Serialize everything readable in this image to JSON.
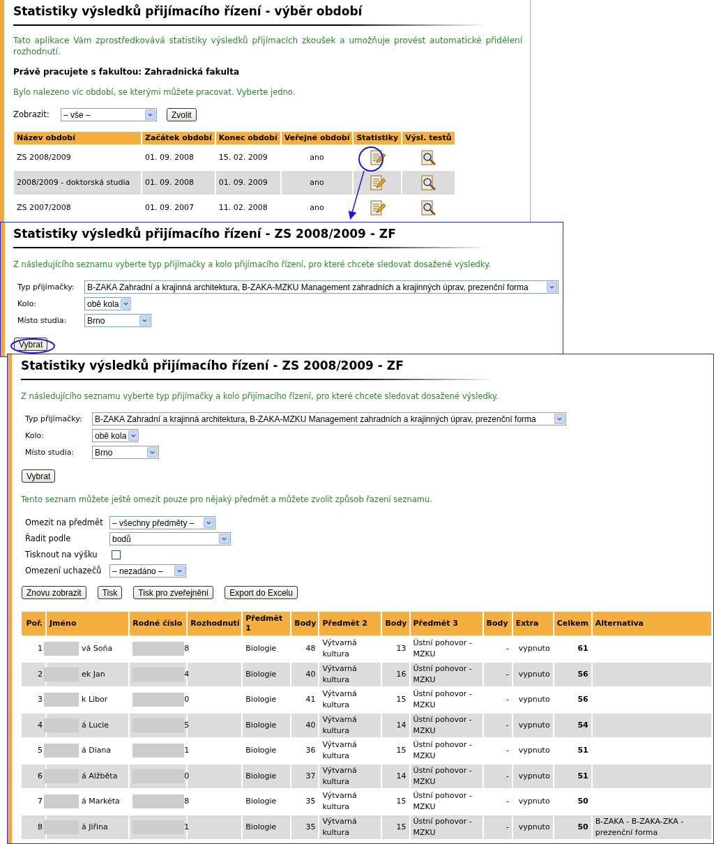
{
  "period_page": {
    "title": "Statistiky výsledků přijímacího řízení - výběr období",
    "intro": "Tato aplikace Vám zprostředkovává statistiky výsledků přijímacích zkoušek a umožňuje provést automatické přidělení rozhodnutí.",
    "faculty": "Právě pracujete s fakultou: Zahradnická fakulta",
    "info": "Bylo nalezeno víc období, se kterými můžete pracovat. Vyberte jedno.",
    "filter": {
      "label": "Zobrazit:",
      "value": "– vše –",
      "button": "Zvolit"
    },
    "table": {
      "columns": [
        "Název období",
        "Začátek období",
        "Konec období",
        "Veřejné období",
        "Statistiky",
        "Výsl. testů"
      ],
      "rows": [
        {
          "name": "ZS 2008/2009",
          "start": "01. 09. 2008",
          "end": "15. 02. 2009",
          "public": "ano"
        },
        {
          "name": "2008/2009 - doktorská studia",
          "start": "01. 09. 2008",
          "end": "01. 09. 2009",
          "public": "ano"
        },
        {
          "name": "ZS 2007/2008",
          "start": "01. 09. 2007",
          "end": "11. 02. 2008",
          "public": "ano"
        }
      ]
    }
  },
  "selection_page": {
    "title": "Statistiky výsledků přijímacího řízení - ZS 2008/2009 - ZF",
    "intro": "Z následujícího seznamu vyberte typ přijímačky a kolo přijímacího řízení, pro které chcete sledovat dosažené výsledky.",
    "fields": [
      {
        "label": "Typ přijímačky:",
        "value": "B-ZAKA Zahradní a krajinná architektura, B-ZAKA-MZKU Management zahradních a krajinných úprav, prezenční forma"
      },
      {
        "label": "Kolo:",
        "value": "obě kola"
      },
      {
        "label": "Místo studia:",
        "value": "Brno"
      }
    ],
    "button": "Vybrat"
  },
  "results_page": {
    "title": "Statistiky výsledků přijímacího řízení - ZS 2008/2009 - ZF",
    "intro": "Z následujícího seznamu vyberte typ přijímačky a kolo přijímacího řízení, pro které chcete sledovat dosažené výsledky.",
    "fields": [
      {
        "label": "Typ přijímačky:",
        "value": "B-ZAKA Zahradní a krajinná architektura, B-ZAKA-MZKU Management zahradních a krajinných úprav, prezenční forma"
      },
      {
        "label": "Kolo:",
        "value": "obě kola"
      },
      {
        "label": "Místo studia:",
        "value": "Brno"
      }
    ],
    "button": "Vybrat",
    "filter_intro": "Tento seznam můžete ještě omezit pouze pro nějaký předmět a můžete zvolit způsob řazení seznamu.",
    "options": [
      {
        "kind": "select",
        "label": "Omezit na předmět",
        "value": "– všechny předměty –"
      },
      {
        "kind": "select",
        "label": "Řadit podle",
        "value": "bodů"
      },
      {
        "kind": "checkbox",
        "label": "Tisknout na výšku",
        "checked": false
      },
      {
        "kind": "select",
        "label": "Omezení uchazečů",
        "value": "– nezadáno –"
      }
    ],
    "actions": [
      "Znovu zobrazit",
      "Tisk",
      "Tisk pro zveřejnění",
      "Export do Excelu"
    ],
    "table": {
      "columns": [
        "Poř.",
        "Jméno",
        "Rodné číslo",
        "Rozhodnutí",
        "Předmět 1",
        "Body",
        "Předmět 2",
        "Body",
        "Předmět 3",
        "Body",
        "Extra",
        "Celkem",
        "Alternativa"
      ],
      "rows": [
        {
          "order": "1",
          "name": "vá Soňa",
          "birth_number": "8",
          "subject_1": "Biologie",
          "points_1": "48",
          "subject_2": "Výtvarná kultura",
          "points_2": "13",
          "subject_3": "Ústní pohovor - MZKU",
          "points_3": "-",
          "extra": "vypnuto",
          "total": "61"
        },
        {
          "order": "2",
          "name": "ek Jan",
          "birth_number": "4",
          "subject_1": "Biologie",
          "points_1": "40",
          "subject_2": "Výtvarná kultura",
          "points_2": "16",
          "subject_3": "Ústní pohovor - MZKU",
          "points_3": "-",
          "extra": "vypnuto",
          "total": "56"
        },
        {
          "order": "3",
          "name": "k Libor",
          "birth_number": "0",
          "subject_1": "Biologie",
          "points_1": "41",
          "subject_2": "Výtvarná kultura",
          "points_2": "15",
          "subject_3": "Ústní pohovor - MZKU",
          "points_3": "-",
          "extra": "vypnuto",
          "total": "56"
        },
        {
          "order": "4",
          "name": "á Lucie",
          "birth_number": "5",
          "subject_1": "Biologie",
          "points_1": "40",
          "subject_2": "Výtvarná kultura",
          "points_2": "14",
          "subject_3": "Ústní pohovor - MZKU",
          "points_3": "-",
          "extra": "vypnuto",
          "total": "54"
        },
        {
          "order": "5",
          "name": "á Diana",
          "birth_number": "1",
          "subject_1": "Biologie",
          "points_1": "36",
          "subject_2": "Výtvarná kultura",
          "points_2": "15",
          "subject_3": "Ústní pohovor - MZKU",
          "points_3": "-",
          "extra": "vypnuto",
          "total": "51"
        },
        {
          "order": "6",
          "name": "á Alžběta",
          "birth_number": "0",
          "subject_1": "Biologie",
          "points_1": "37",
          "subject_2": "Výtvarná kultura",
          "points_2": "14",
          "subject_3": "Ústní pohovor - MZKU",
          "points_3": "-",
          "extra": "vypnuto",
          "total": "51"
        },
        {
          "order": "7",
          "name": "á Markéta",
          "birth_number": "8",
          "subject_1": "Biologie",
          "points_1": "35",
          "subject_2": "Výtvarná kultura",
          "points_2": "15",
          "subject_3": "Ústní pohovor - MZKU",
          "points_3": "-",
          "extra": "vypnuto",
          "total": "50"
        },
        {
          "order": "8",
          "name": "á Jiřina",
          "birth_number": "1",
          "subject_1": "Biologie",
          "points_1": "35",
          "subject_2": "Výtvarná kultura",
          "points_2": "15",
          "subject_3": "Ústní pohovor - MZKU",
          "points_3": "-",
          "extra": "vypnuto",
          "total": "50",
          "alternative": "B-ZAKA - B-ZAKA-ZKA - prezenční forma"
        }
      ]
    }
  }
}
